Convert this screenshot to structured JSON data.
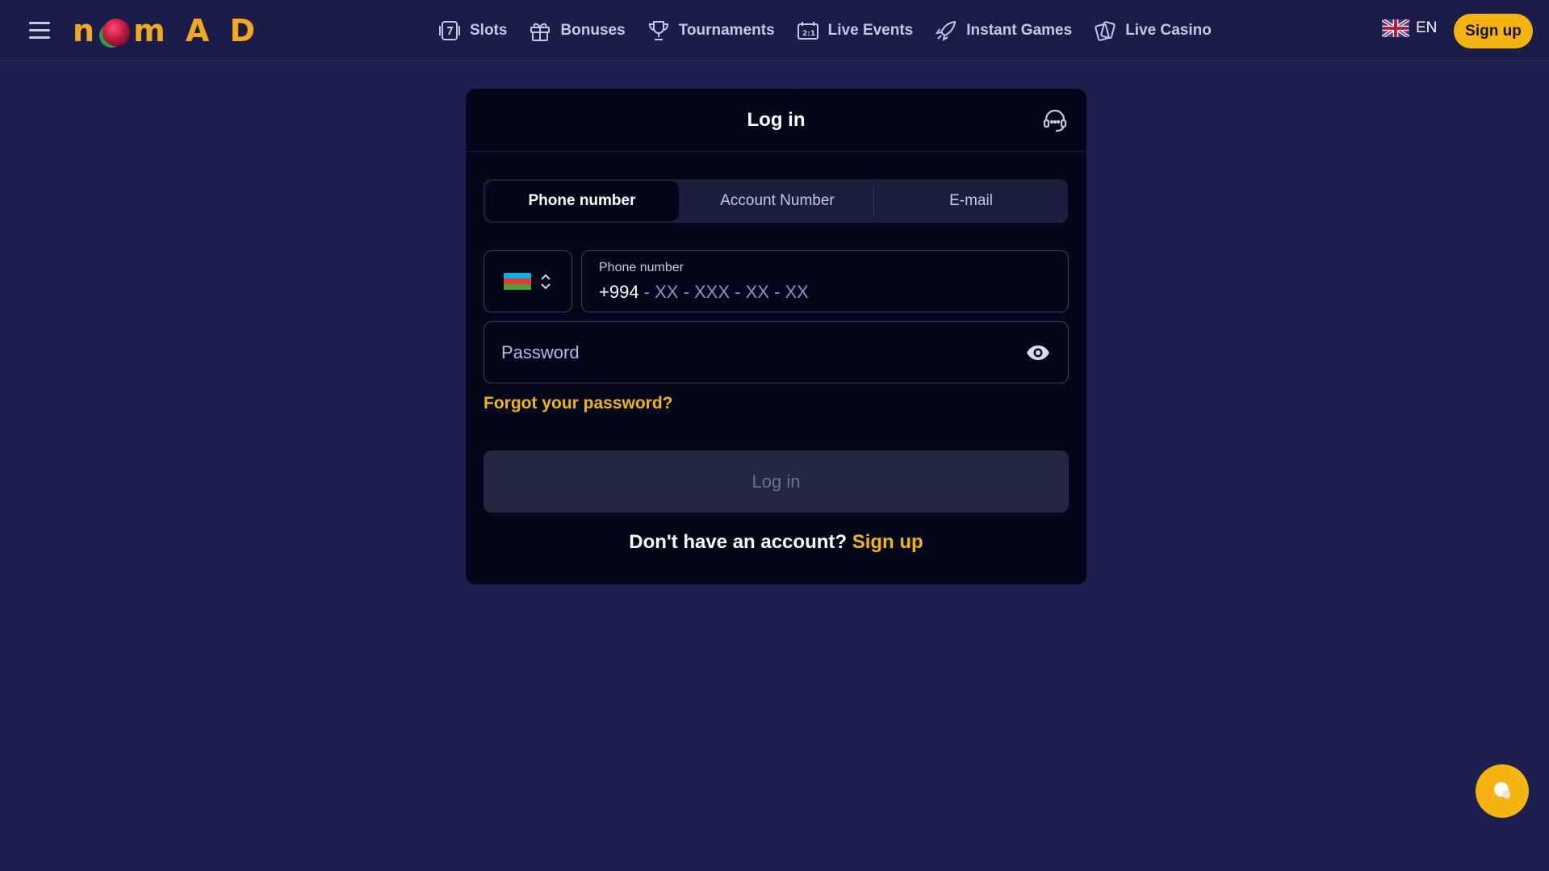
{
  "header": {
    "logo": {
      "left": "n",
      "right": "m A D"
    },
    "nav": [
      {
        "label": "Slots",
        "icon": "slot-machine-icon"
      },
      {
        "label": "Bonuses",
        "icon": "gift-icon"
      },
      {
        "label": "Tournaments",
        "icon": "trophy-icon"
      },
      {
        "label": "Live Events",
        "icon": "scoreboard-icon"
      },
      {
        "label": "Instant Games",
        "icon": "rocket-icon"
      },
      {
        "label": "Live Casino",
        "icon": "playing-cards-icon"
      }
    ],
    "language": "EN",
    "signup_label": "Sign up"
  },
  "login": {
    "title": "Log in",
    "tabs": [
      {
        "label": "Phone number",
        "active": true
      },
      {
        "label": "Account Number",
        "active": false
      },
      {
        "label": "E-mail",
        "active": false
      }
    ],
    "phone": {
      "label": "Phone number",
      "code": "+994",
      "mask": " - XX - XXX - XX - XX"
    },
    "password_placeholder": "Password",
    "forgot_label": "Forgot your password?",
    "submit_label": "Log in",
    "no_account_text": "Don't have an account?",
    "signup_link": "Sign up"
  },
  "colors": {
    "background": "#1c1f4f",
    "modal": "#04071a",
    "accent": "#f5b40f"
  }
}
